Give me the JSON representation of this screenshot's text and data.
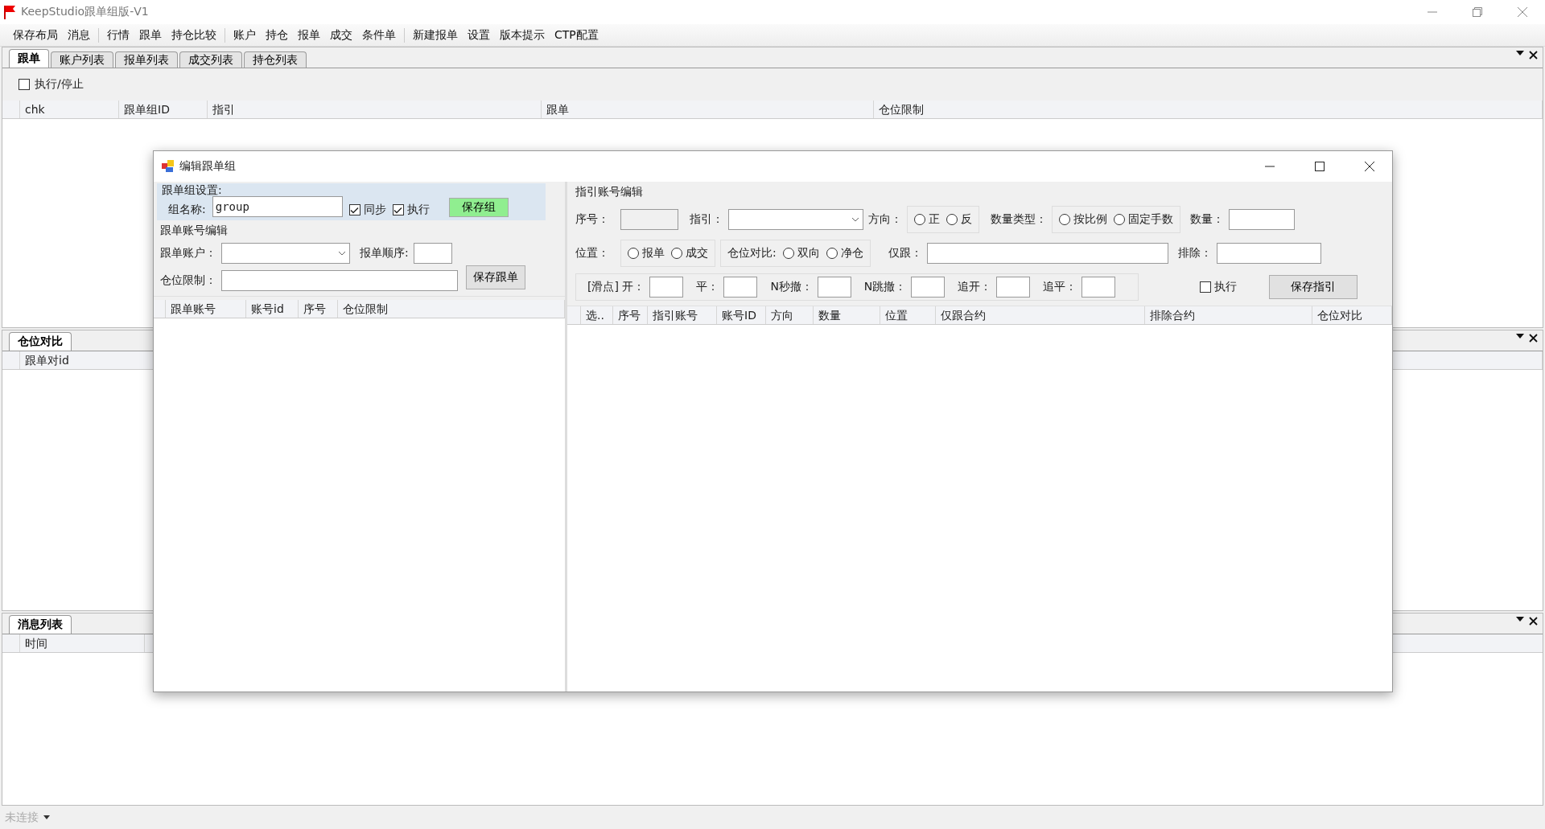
{
  "window": {
    "title": "KeepStudio跟单组版-V1"
  },
  "menu_groups": [
    [
      "保存布局",
      "消息"
    ],
    [
      "行情",
      "跟单",
      "持仓比较"
    ],
    [
      "账户",
      "持仓",
      "报单",
      "成交",
      "条件单"
    ],
    [
      "新建报单",
      "设置",
      "版本提示",
      "CTP配置"
    ]
  ],
  "main_panel": {
    "tabs": [
      {
        "label": "跟单",
        "selected": true
      },
      {
        "label": "账户列表",
        "selected": false
      },
      {
        "label": "报单列表",
        "selected": false
      },
      {
        "label": "成交列表",
        "selected": false
      },
      {
        "label": "持仓列表",
        "selected": false
      }
    ],
    "run_toggle": {
      "label": "执行/停止",
      "checked": false
    },
    "columns": [
      "chk",
      "跟单组ID",
      "指引",
      "跟单",
      "仓位限制"
    ]
  },
  "position_panel": {
    "tab": "仓位对比",
    "columns": [
      "跟单对id"
    ]
  },
  "message_panel": {
    "tab": "消息列表",
    "columns": [
      "时间"
    ]
  },
  "status_bar": {
    "connection": "未连接"
  },
  "dialog": {
    "title": "编辑跟单组",
    "group_settings": {
      "heading": "跟单组设置:",
      "name_label": "组名称:",
      "name_value": "group",
      "options": [
        {
          "label": "同步",
          "checked": true
        },
        {
          "label": "执行",
          "checked": true
        }
      ],
      "save_button": "保存组"
    },
    "account_edit": {
      "heading": "跟单账号编辑",
      "account_label": "跟单账户：",
      "order_label": "报单顺序:",
      "limit_label": "仓位限制：",
      "save_button": "保存跟单"
    },
    "account_columns": [
      "跟单账号",
      "账号id",
      "序号",
      "仓位限制"
    ],
    "guide_edit": {
      "heading": "指引账号编辑",
      "seq_label": "序号：",
      "guide_label": "指引：",
      "direction_label": "方向：",
      "directions": [
        {
          "label": "正",
          "selected": false
        },
        {
          "label": "反",
          "selected": false
        }
      ],
      "qty_type_label": "数量类型：",
      "qty_types": [
        {
          "label": "按比例",
          "selected": false
        },
        {
          "label": "固定手数",
          "selected": false
        }
      ],
      "qty_label": "数量：",
      "position_label": "位置：",
      "positions": [
        {
          "label": "报单",
          "selected": false
        },
        {
          "label": "成交",
          "selected": false
        }
      ],
      "compare_label": "仓位对比:",
      "compares": [
        {
          "label": "双向",
          "selected": false
        },
        {
          "label": "净仓",
          "selected": false
        }
      ],
      "only_label": "仅跟：",
      "exclude_label": "排除：",
      "slip_fields": [
        "[滑点] 开：",
        "平：",
        "N秒撤：",
        "N跳撤：",
        "追开：",
        "追平："
      ],
      "run": {
        "label": "执行",
        "checked": false
      },
      "save_button": "保存指引"
    },
    "guide_columns": [
      "选..",
      "序号",
      "指引账号",
      "账号ID",
      "方向",
      "数量",
      "位置",
      "仅跟合约",
      "排除合约",
      "仓位对比"
    ]
  }
}
